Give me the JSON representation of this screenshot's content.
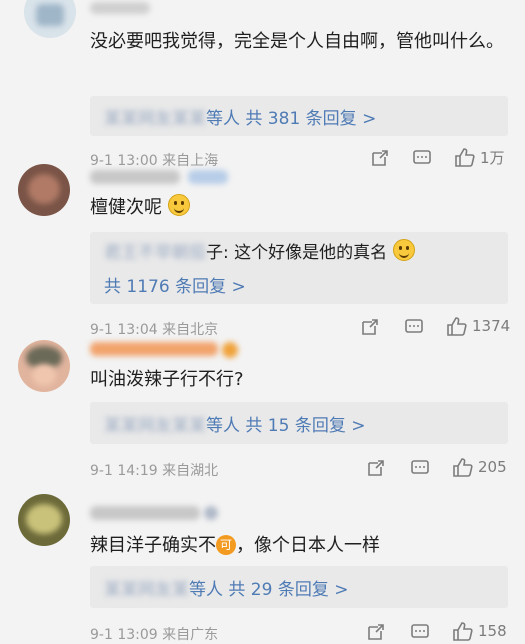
{
  "comments": [
    {
      "text": "没必要吧我觉得，完全是个人自由啊，管他叫什么。",
      "reply_link": "共 381 条回复 >",
      "reply_suffix": "等人"
    },
    {
      "meta": "9-1 13:00 来自上海",
      "likes": "1万",
      "text": "檀健次呢",
      "reply_text": "子: 这个好像是他的真名",
      "reply_link": "共 1176 条回复 >"
    },
    {
      "meta": "9-1 13:04 来自北京",
      "likes": "1374",
      "text": "叫油泼辣子行不行?",
      "reply_suffix": "等人",
      "reply_link": "共 15 条回复 >"
    },
    {
      "meta": "9-1 14:19 来自湖北",
      "likes": "205",
      "text_before": "辣目洋子确实不",
      "badge": "可",
      "text_after": "，像个日本人一样",
      "reply_suffix": "等人",
      "reply_link": "共 29 条回复 >"
    },
    {
      "meta": "9-1 13:09 来自广东",
      "likes": "158"
    }
  ],
  "colors": {
    "link": "#4f7bb5",
    "background": "#f3f3f3",
    "reply_bg": "#e9e9e9"
  }
}
